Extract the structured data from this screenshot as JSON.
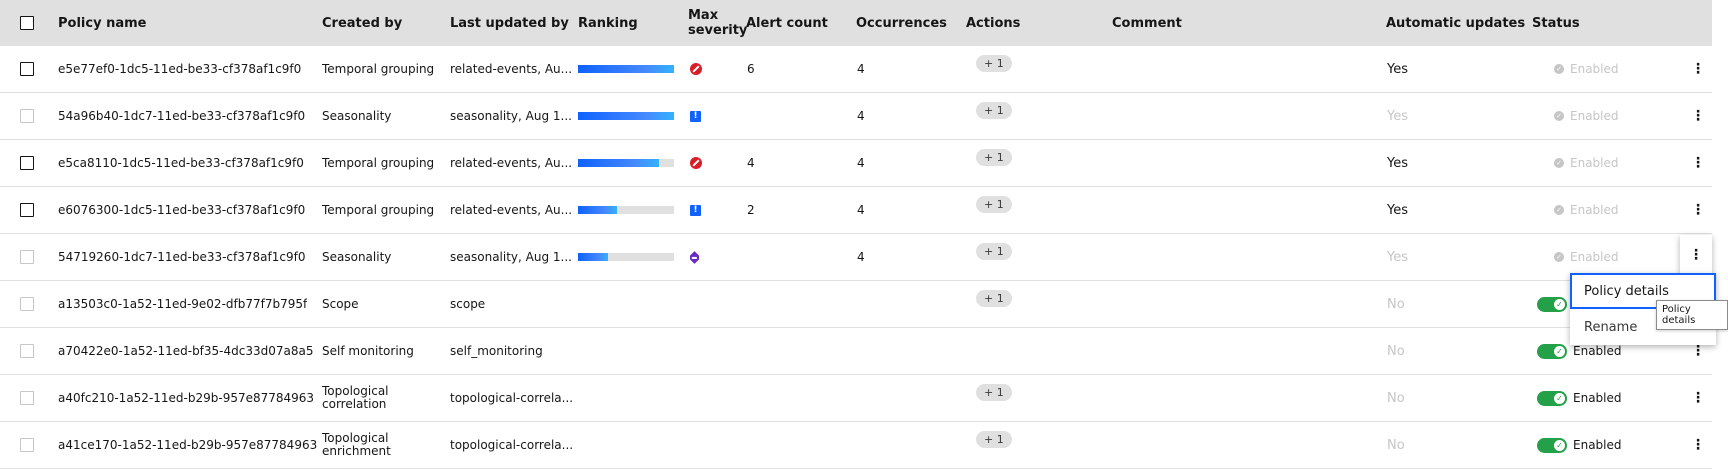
{
  "columns": {
    "policy_name": "Policy name",
    "created_by": "Created by",
    "last_updated_by": "Last updated by",
    "ranking": "Ranking",
    "max_severity_line1": "Max",
    "max_severity_line2": "severity",
    "alert_count": "Alert count",
    "occurrences": "Occurrences",
    "actions": "Actions",
    "comment": "Comment",
    "automatic_updates": "Automatic updates",
    "status": "Status"
  },
  "rows": [
    {
      "name": "e5e77ef0-1dc5-11ed-be33-cf378af1c9f0",
      "created_by": "Temporal grouping",
      "created_by2": "",
      "updated_by": "related-events, Au...",
      "ranking": 1.0,
      "severity": "critical",
      "severity_icon": "critical-severity-icon",
      "alert_count": "6",
      "occurrences": "4",
      "action": "+ 1",
      "auto": "Yes",
      "status": "Enabled",
      "checkbox_enabled": true,
      "auto_dim": false,
      "status_type": "dim"
    },
    {
      "name": "54a96b40-1dc7-11ed-be33-cf378af1c9f0",
      "created_by": "Seasonality",
      "created_by2": "",
      "updated_by": "seasonality, Aug 1...",
      "ranking": 1.0,
      "severity": "major",
      "severity_icon": "major-severity-icon",
      "alert_count": "",
      "occurrences": "4",
      "action": "+ 1",
      "auto": "Yes",
      "status": "Enabled",
      "checkbox_enabled": false,
      "auto_dim": true,
      "status_type": "dim"
    },
    {
      "name": "e5ca8110-1dc5-11ed-be33-cf378af1c9f0",
      "created_by": "Temporal grouping",
      "created_by2": "",
      "updated_by": "related-events, Au...",
      "ranking": 0.84,
      "severity": "critical",
      "severity_icon": "critical-severity-icon",
      "alert_count": "4",
      "occurrences": "4",
      "action": "+ 1",
      "auto": "Yes",
      "status": "Enabled",
      "checkbox_enabled": true,
      "auto_dim": false,
      "status_type": "dim"
    },
    {
      "name": "e6076300-1dc5-11ed-be33-cf378af1c9f0",
      "created_by": "Temporal grouping",
      "created_by2": "",
      "updated_by": "related-events, Au...",
      "ranking": 0.41,
      "severity": "major",
      "severity_icon": "major-severity-icon",
      "alert_count": "2",
      "occurrences": "4",
      "action": "+ 1",
      "auto": "Yes",
      "status": "Enabled",
      "checkbox_enabled": true,
      "auto_dim": false,
      "status_type": "dim"
    },
    {
      "name": "54719260-1dc7-11ed-be33-cf378af1c9f0",
      "created_by": "Seasonality",
      "created_by2": "",
      "updated_by": "seasonality, Aug 1...",
      "ranking": 0.31,
      "severity": "info",
      "severity_icon": "information-severity-icon",
      "alert_count": "",
      "occurrences": "4",
      "action": "+ 1",
      "auto": "Yes",
      "status": "Enabled",
      "checkbox_enabled": false,
      "auto_dim": true,
      "status_type": "dim"
    },
    {
      "name": "a13503c0-1a52-11ed-9e02-dfb77f7b795f",
      "created_by": "Scope",
      "created_by2": "",
      "updated_by": "scope",
      "ranking": null,
      "severity": "",
      "severity_icon": "",
      "alert_count": "",
      "occurrences": "",
      "action": "+ 1",
      "auto": "No",
      "status": "",
      "checkbox_enabled": false,
      "auto_dim": true,
      "status_type": "toggle"
    },
    {
      "name": "a70422e0-1a52-11ed-bf35-4dc33d07a8a5",
      "created_by": "Self monitoring",
      "created_by2": "",
      "updated_by": "self_monitoring",
      "ranking": null,
      "severity": "",
      "severity_icon": "",
      "alert_count": "",
      "occurrences": "",
      "action": "",
      "auto": "No",
      "status": "Enabled",
      "checkbox_enabled": false,
      "auto_dim": true,
      "status_type": "toggle"
    },
    {
      "name": "a40fc210-1a52-11ed-b29b-957e87784963",
      "created_by": "Topological",
      "created_by2": "correlation",
      "updated_by": "topological-correla...",
      "ranking": null,
      "severity": "",
      "severity_icon": "",
      "alert_count": "",
      "occurrences": "",
      "action": "+ 1",
      "auto": "No",
      "status": "Enabled",
      "checkbox_enabled": false,
      "auto_dim": true,
      "status_type": "toggle"
    },
    {
      "name": "a41ce170-1a52-11ed-b29b-957e87784963",
      "created_by": "Topological",
      "created_by2": "enrichment",
      "updated_by": "topological-correla...",
      "ranking": null,
      "severity": "",
      "severity_icon": "",
      "alert_count": "",
      "occurrences": "",
      "action": "+ 1",
      "auto": "No",
      "status": "Enabled",
      "checkbox_enabled": false,
      "auto_dim": true,
      "status_type": "toggle"
    }
  ],
  "overflow_menu": {
    "items": [
      "Policy details",
      "Rename"
    ],
    "tooltip": "Policy details",
    "icon": "overflow-menu-vertical-icon"
  },
  "colors": {
    "header_bg": "#e0e0e0",
    "ranking_blue": "#0f62fe",
    "critical": "#da1e28",
    "major": "#0f62fe",
    "info": "#6929c4",
    "toggle_on": "#24a148",
    "disabled_text": "#c6c6c6",
    "focus": "#0f62fe"
  }
}
